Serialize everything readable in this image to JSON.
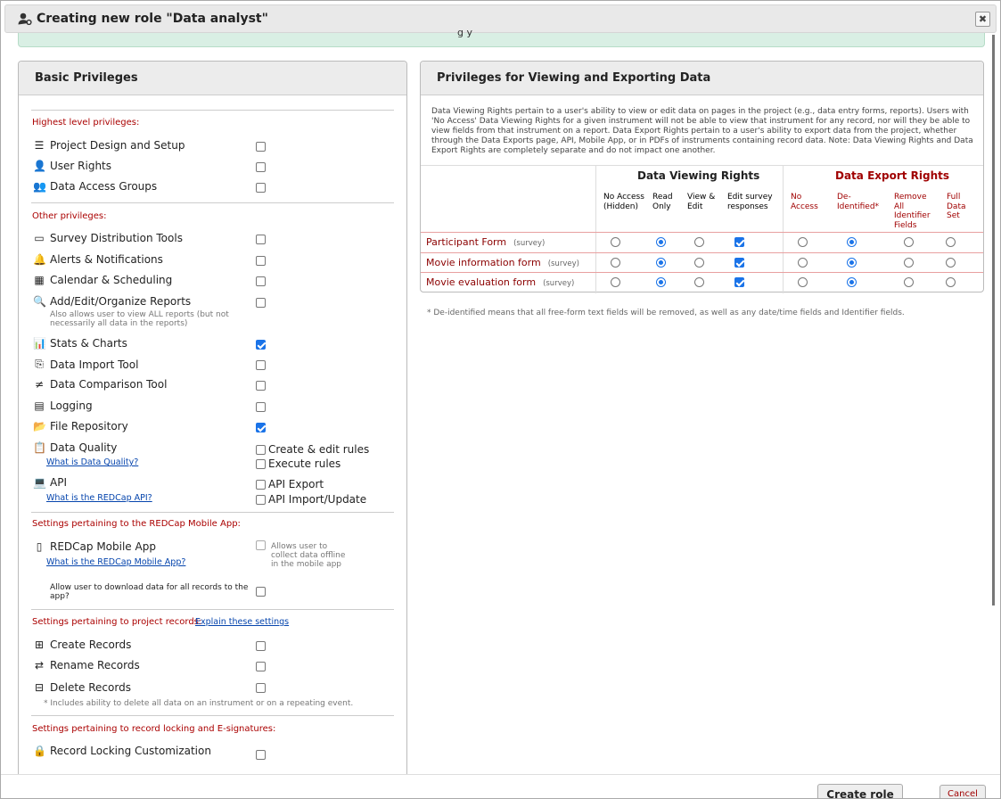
{
  "dialog": {
    "title": "Creating new role \"Data analyst\"",
    "close_label": "✖",
    "banner_fragment": "g                    y"
  },
  "left": {
    "title": "Basic Privileges",
    "sections": {
      "highest": "Highest level privileges:",
      "other": "Other privileges:",
      "mobile": "Settings pertaining to the REDCap Mobile App:",
      "records": "Settings pertaining to project records:",
      "records_link": "Explain these settings",
      "locking": "Settings pertaining to record locking and E-signatures:"
    },
    "items": {
      "project_design": "Project Design and Setup",
      "user_rights": "User Rights",
      "dag": "Data Access Groups",
      "survey_tools": "Survey Distribution Tools",
      "alerts": "Alerts & Notifications",
      "calendar": "Calendar & Scheduling",
      "reports": "Add/Edit/Organize Reports",
      "reports_note": "Also allows user to view ALL reports (but not necessarily all data in the reports)",
      "stats": "Stats & Charts",
      "import": "Data Import Tool",
      "comparison": "Data Comparison Tool",
      "logging": "Logging",
      "file_repo": "File Repository",
      "data_quality": "Data Quality",
      "dq_link": "What is Data Quality?",
      "dq_create": "Create & edit rules",
      "dq_execute": "Execute rules",
      "api": "API",
      "api_link": "What is the REDCap API?",
      "api_export": "API Export",
      "api_import": "API Import/Update",
      "mobile_app": "REDCap Mobile App",
      "mobile_link": "What is the REDCap Mobile App?",
      "mobile_note": "Allows user to collect data offline in the mobile app",
      "mobile_download": "Allow user to download data for all records to the app?",
      "create_records": "Create Records",
      "rename_records": "Rename Records",
      "delete_records": "Delete Records",
      "delete_note": "* Includes ability to delete all data on an instrument or on a repeating event.",
      "locking_custom": "Record Locking Customization"
    },
    "checked": {
      "stats": true,
      "file_repo": true
    }
  },
  "right": {
    "title": "Privileges for Viewing and Exporting Data",
    "description": "Data Viewing Rights pertain to a user's ability to view or edit data on pages in the project (e.g., data entry forms, reports). Users with 'No Access' Data Viewing Rights for a given instrument will not be able to view that instrument for any record, nor will they be able to view fields from that instrument on a report. Data Export Rights pertain to a user's ability to export data from the project, whether through the Data Exports page, API, Mobile App, or in PDFs of instruments containing record data. Note: Data Viewing Rights and Data Export Rights are completely separate and do not impact one another.",
    "viewing_header": "Data Viewing Rights",
    "export_header": "Data Export Rights",
    "viewing_cols": [
      "No Access (Hidden)",
      "Read Only",
      "View & Edit",
      "Edit survey responses"
    ],
    "export_cols": [
      "No Access",
      "De-Identified*",
      "Remove All Identifier Fields",
      "Full Data Set"
    ],
    "rows": [
      {
        "name": "Participant Form",
        "tag": "(survey)",
        "view": 1,
        "edit_survey": true,
        "export": 1
      },
      {
        "name": "Movie information form",
        "tag": "(survey)",
        "view": 1,
        "edit_survey": true,
        "export": 1
      },
      {
        "name": "Movie evaluation form",
        "tag": "(survey)",
        "view": 1,
        "edit_survey": true,
        "export": 1
      }
    ],
    "footnote": "* De-identified means that all free-form text fields will be removed, as well as any date/time fields and Identifier fields."
  },
  "footer": {
    "create": "Create role",
    "cancel": "Cancel"
  },
  "colors": {
    "accent": "#1a73e8",
    "section_red": "#aa0000",
    "export_red": "#a00000",
    "banner_green": "#d9efe4"
  }
}
